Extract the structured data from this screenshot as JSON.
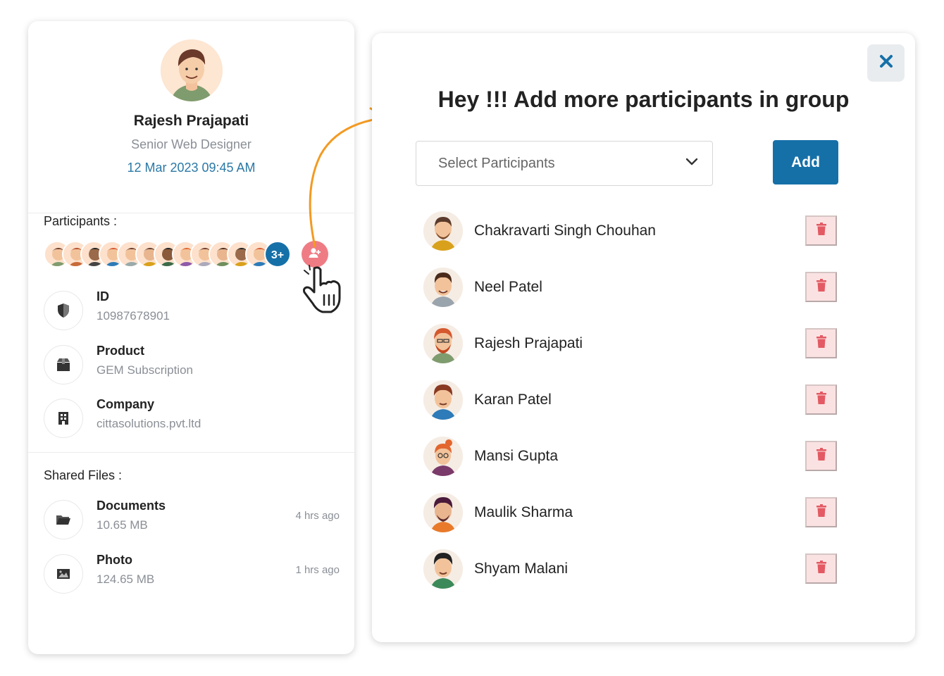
{
  "profile": {
    "name": "Rajesh Prajapati",
    "role": "Senior Web Designer",
    "datetime": "12 Mar 2023 09:45 AM"
  },
  "participants": {
    "title": "Participants :",
    "more_count": "3+"
  },
  "details": [
    {
      "label": "ID",
      "value": "10987678901",
      "icon": "shield-icon"
    },
    {
      "label": "Product",
      "value": "GEM Subscription",
      "icon": "box-icon"
    },
    {
      "label": "Company",
      "value": "cittasolutions.pvt.ltd",
      "icon": "building-icon"
    }
  ],
  "shared_files": {
    "title": "Shared Files :",
    "items": [
      {
        "label": "Documents",
        "size": "10.65 MB",
        "time": "4 hrs ago",
        "icon": "folder-icon"
      },
      {
        "label": "Photo",
        "size": "124.65 MB",
        "time": "1 hrs ago",
        "icon": "image-icon"
      }
    ]
  },
  "modal": {
    "title": "Hey !!! Add more participants in group",
    "select_placeholder": "Select Participants",
    "add_label": "Add",
    "participants": [
      {
        "name": "Chakravarti Singh Chouhan"
      },
      {
        "name": "Neel Patel"
      },
      {
        "name": "Rajesh Prajapati"
      },
      {
        "name": "Karan Patel"
      },
      {
        "name": "Mansi Gupta"
      },
      {
        "name": "Maulik Sharma"
      },
      {
        "name": "Shyam Malani"
      }
    ]
  },
  "colors": {
    "accent": "#1670a8",
    "date": "#2a78a6",
    "add_user": "#ef7c84",
    "delete_bg": "#fbe2e2",
    "delete_icon": "#e35a64",
    "arrow": "#f39a22"
  }
}
